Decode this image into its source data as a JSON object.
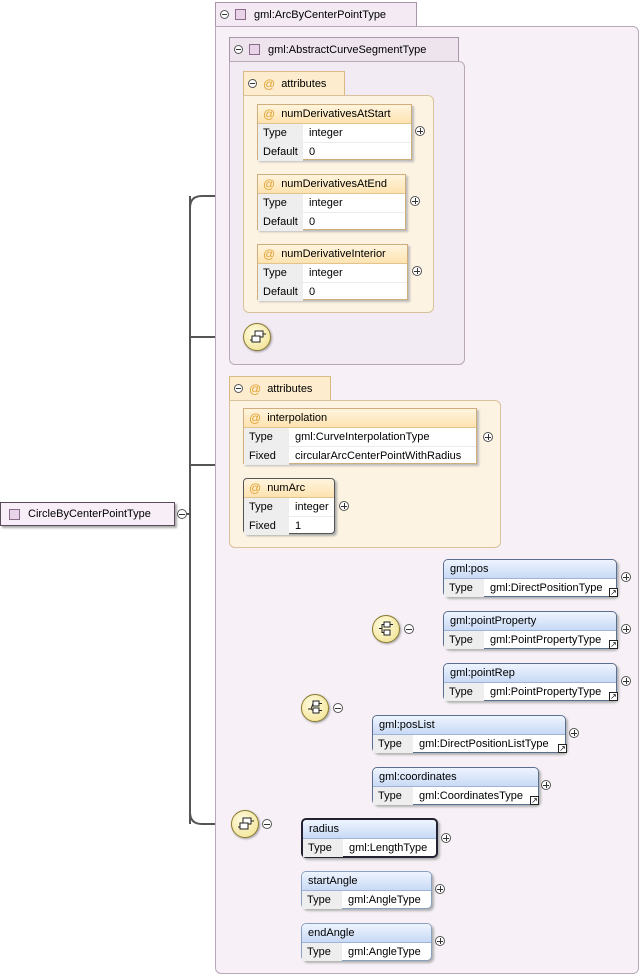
{
  "root": {
    "name": "CircleByCenterPointType"
  },
  "outer_type": {
    "name": "gml:ArcByCenterPointType"
  },
  "inner_type": {
    "name": "gml:AbstractCurveSegmentType"
  },
  "inner_attributes": {
    "label": "attributes",
    "items": [
      {
        "name": "numDerivativesAtStart",
        "type_label": "Type",
        "type": "integer",
        "default_label": "Default",
        "default": "0"
      },
      {
        "name": "numDerivativesAtEnd",
        "type_label": "Type",
        "type": "integer",
        "default_label": "Default",
        "default": "0"
      },
      {
        "name": "numDerivativeInterior",
        "type_label": "Type",
        "type": "integer",
        "default_label": "Default",
        "default": "0"
      }
    ]
  },
  "outer_attributes": {
    "label": "attributes",
    "items": [
      {
        "name": "interpolation",
        "type_label": "Type",
        "type": "gml:CurveInterpolationType",
        "fixed_label": "Fixed",
        "fixed": "circularArcCenterPointWithRadius"
      },
      {
        "name": "numArc",
        "type_label": "Type",
        "type": "integer",
        "fixed_label": "Fixed",
        "fixed": "1"
      }
    ]
  },
  "elements": {
    "pos": {
      "name": "gml:pos",
      "type_label": "Type",
      "type": "gml:DirectPositionType"
    },
    "pointProperty": {
      "name": "gml:pointProperty",
      "type_label": "Type",
      "type": "gml:PointPropertyType"
    },
    "pointRep": {
      "name": "gml:pointRep",
      "type_label": "Type",
      "type": "gml:PointPropertyType"
    },
    "posList": {
      "name": "gml:posList",
      "type_label": "Type",
      "type": "gml:DirectPositionListType"
    },
    "coordinates": {
      "name": "gml:coordinates",
      "type_label": "Type",
      "type": "gml:CoordinatesType"
    },
    "radius": {
      "name": "radius",
      "type_label": "Type",
      "type": "gml:LengthType"
    },
    "startAngle": {
      "name": "startAngle",
      "type_label": "Type",
      "type": "gml:AngleType"
    },
    "endAngle": {
      "name": "endAngle",
      "type_label": "Type",
      "type": "gml:AngleType"
    }
  }
}
